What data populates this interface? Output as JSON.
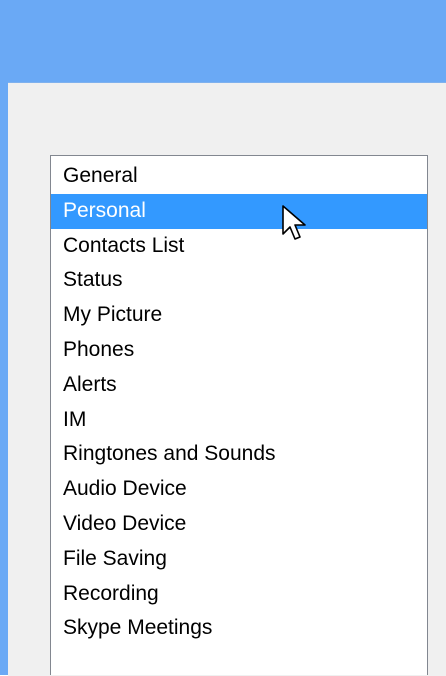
{
  "options": {
    "categories": [
      {
        "label": "General",
        "selected": false
      },
      {
        "label": "Personal",
        "selected": true
      },
      {
        "label": "Contacts List",
        "selected": false
      },
      {
        "label": "Status",
        "selected": false
      },
      {
        "label": "My Picture",
        "selected": false
      },
      {
        "label": "Phones",
        "selected": false
      },
      {
        "label": "Alerts",
        "selected": false
      },
      {
        "label": "IM",
        "selected": false
      },
      {
        "label": "Ringtones and Sounds",
        "selected": false
      },
      {
        "label": "Audio Device",
        "selected": false
      },
      {
        "label": "Video Device",
        "selected": false
      },
      {
        "label": "File Saving",
        "selected": false
      },
      {
        "label": "Recording",
        "selected": false
      },
      {
        "label": "Skype Meetings",
        "selected": false
      }
    ]
  },
  "colors": {
    "titlebar": "#6aa9f5",
    "selection": "#3399ff",
    "client_background": "#f0f0f0"
  },
  "icons": {
    "pointer": "mouse-pointer-icon"
  }
}
